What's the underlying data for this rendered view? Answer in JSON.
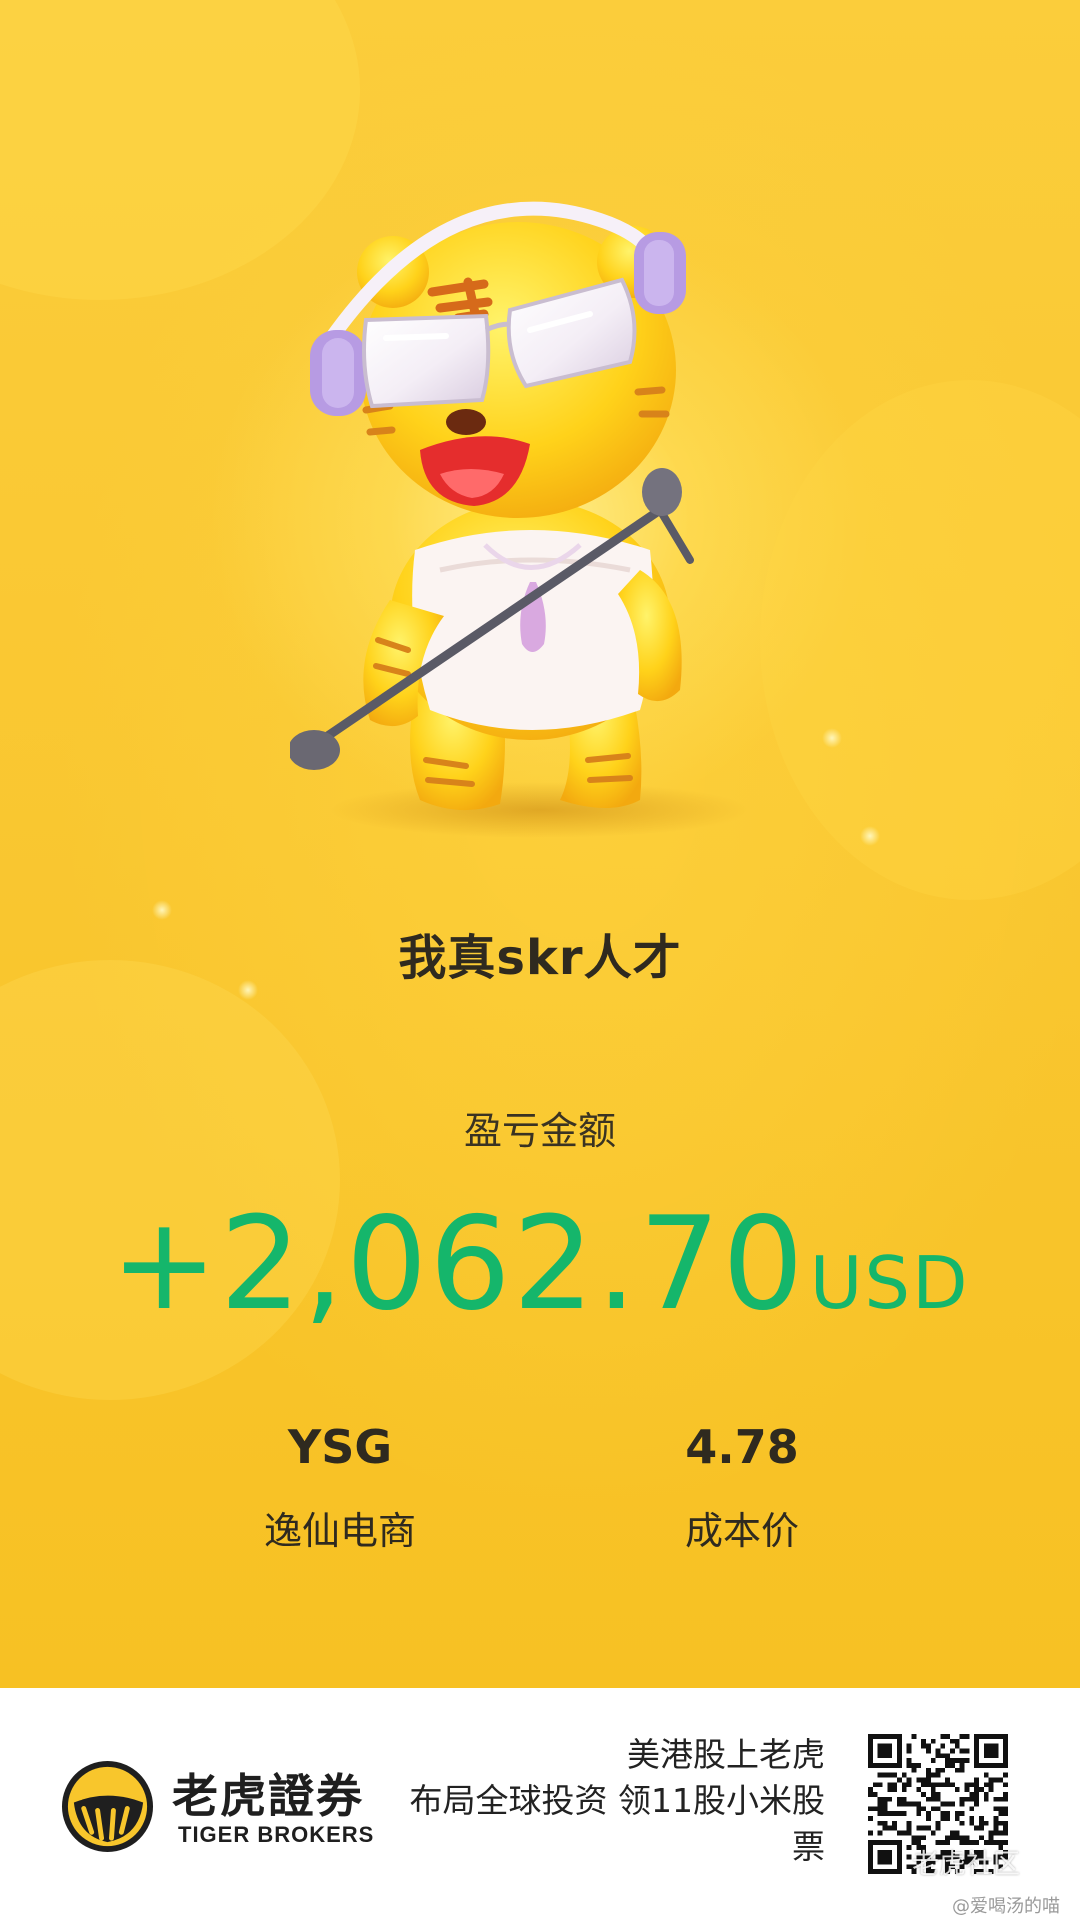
{
  "poster": {
    "title": "我真skr人才",
    "pnl_label": "盈亏金额",
    "pnl_value": "+2,062.70",
    "pnl_currency": "USD",
    "stock": {
      "ticker": "YSG",
      "name": "逸仙电商"
    },
    "cost": {
      "value": "4.78",
      "label": "成本价"
    },
    "mascot_icon": "tiger-mascot-with-microphone",
    "colors": {
      "background": "#f8c62c",
      "profit": "#15b66b",
      "text": "#2f2a1f"
    }
  },
  "footer": {
    "brand_cn": "老虎證券",
    "brand_en": "TIGER BROKERS",
    "slogan_line1": "美港股上老虎",
    "slogan_line2": "布局全球投资 领11股小米股",
    "slogan_line3": "票",
    "qr_icon": "qr-code",
    "watermark_overlay": "老虎社区",
    "watermark_user": "@爱喝汤的喵"
  }
}
